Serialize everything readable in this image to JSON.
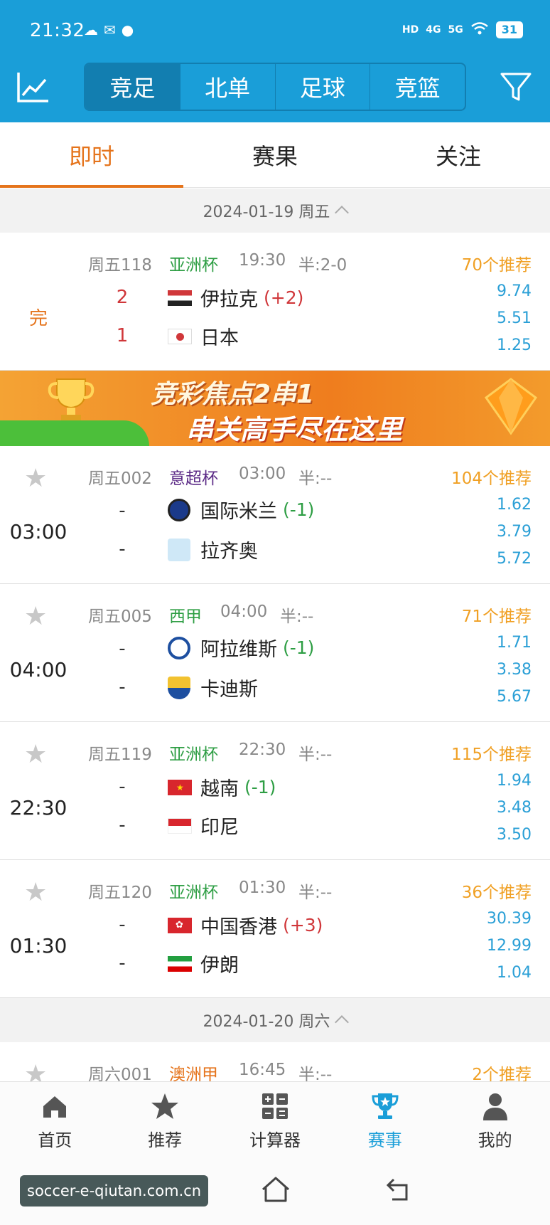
{
  "status_bar": {
    "time": "21:32",
    "network1": "4G",
    "network2": "5G",
    "hd": "HD",
    "battery": "31"
  },
  "top_tabs": [
    {
      "label": "竞足",
      "active": true
    },
    {
      "label": "北单",
      "active": false
    },
    {
      "label": "足球",
      "active": false
    },
    {
      "label": "竞篮",
      "active": false
    }
  ],
  "sub_tabs": [
    {
      "label": "即时",
      "active": true
    },
    {
      "label": "赛果",
      "active": false
    },
    {
      "label": "关注",
      "active": false
    }
  ],
  "date_sections": [
    {
      "date": "2024-01-19 周五"
    },
    {
      "date": "2024-01-20 周六"
    }
  ],
  "matches": [
    {
      "status": "完",
      "code": "周五118",
      "league": "亚洲杯",
      "time": "19:30",
      "half": "半:2-0",
      "recommend": "70个推荐",
      "home": {
        "score": "2",
        "name": "伊拉克",
        "handicap": "(+2)"
      },
      "away": {
        "score": "1",
        "name": "日本"
      },
      "odds": [
        "9.74",
        "5.51",
        "1.25"
      ]
    },
    {
      "status": "03:00",
      "code": "周五002",
      "league": "意超杯",
      "time": "03:00",
      "half": "半:--",
      "recommend": "104个推荐",
      "home": {
        "score": "-",
        "name": "国际米兰",
        "handicap": "(-1)"
      },
      "away": {
        "score": "-",
        "name": "拉齐奥"
      },
      "odds": [
        "1.62",
        "3.79",
        "5.72"
      ]
    },
    {
      "status": "04:00",
      "code": "周五005",
      "league": "西甲",
      "time": "04:00",
      "half": "半:--",
      "recommend": "71个推荐",
      "home": {
        "score": "-",
        "name": "阿拉维斯",
        "handicap": "(-1)"
      },
      "away": {
        "score": "-",
        "name": "卡迪斯"
      },
      "odds": [
        "1.71",
        "3.38",
        "5.67"
      ]
    },
    {
      "status": "22:30",
      "code": "周五119",
      "league": "亚洲杯",
      "time": "22:30",
      "half": "半:--",
      "recommend": "115个推荐",
      "home": {
        "score": "-",
        "name": "越南",
        "handicap": "(-1)"
      },
      "away": {
        "score": "-",
        "name": "印尼"
      },
      "odds": [
        "1.94",
        "3.48",
        "3.50"
      ]
    },
    {
      "status": "01:30",
      "code": "周五120",
      "league": "亚洲杯",
      "time": "01:30",
      "half": "半:--",
      "recommend": "36个推荐",
      "home": {
        "score": "-",
        "name": "中国香港",
        "handicap": "(+3)"
      },
      "away": {
        "score": "-",
        "name": "伊朗"
      },
      "odds": [
        "30.39",
        "12.99",
        "1.04"
      ]
    },
    {
      "code": "周六001",
      "league": "澳洲甲",
      "time": "16:45",
      "half": "半:--",
      "recommend": "2个推荐"
    }
  ],
  "banner": {
    "line1": "竞彩焦点2串1",
    "line2": "串关高手尽在这里"
  },
  "bottom_nav": [
    {
      "label": "首页",
      "icon": "home-icon"
    },
    {
      "label": "推荐",
      "icon": "star-icon"
    },
    {
      "label": "计算器",
      "icon": "calculator-icon"
    },
    {
      "label": "赛事",
      "icon": "trophy-icon",
      "active": true
    },
    {
      "label": "我的",
      "icon": "person-icon"
    }
  ],
  "watermark": "soccer-e-qiutan.com.cn",
  "colors": {
    "primary": "#1a9ed8",
    "accent": "#e5741c",
    "odds": "#2a9fd6",
    "recommend": "#f0a024",
    "league_green": "#2e9e44",
    "league_purple": "#5b2a86",
    "score_red": "#d0373a"
  }
}
